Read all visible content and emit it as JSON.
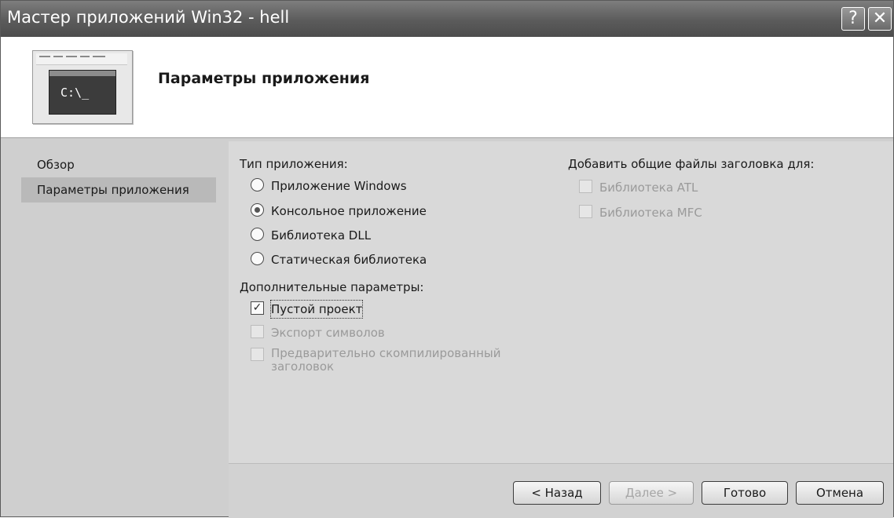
{
  "window": {
    "title": "Мастер приложений Win32 - hell"
  },
  "titlebar_buttons": {
    "help": "?",
    "close": "✕"
  },
  "header": {
    "heading": "Параметры приложения",
    "console_prompt": "C:\\_"
  },
  "nav": {
    "items": [
      {
        "label": "Обзор"
      },
      {
        "label": "Параметры приложения"
      }
    ]
  },
  "app_type": {
    "heading": "Тип приложения:",
    "options": [
      {
        "label": "Приложение Windows",
        "selected": false
      },
      {
        "label": "Консольное приложение",
        "selected": true
      },
      {
        "label": "Библиотека DLL",
        "selected": false
      },
      {
        "label": "Статическая библиотека",
        "selected": false
      }
    ]
  },
  "extra": {
    "heading": "Дополнительные параметры:",
    "options": [
      {
        "label": "Пустой проект",
        "checked": true,
        "enabled": true
      },
      {
        "label": "Экспорт символов",
        "checked": false,
        "enabled": false
      },
      {
        "label_line1": "Предварительно скомпилированный",
        "label_line2": "заголовок",
        "checked": false,
        "enabled": false
      }
    ]
  },
  "headers": {
    "heading": "Добавить общие файлы заголовка для:",
    "options": [
      {
        "label": "Библиотека ATL",
        "checked": false,
        "enabled": false
      },
      {
        "label": "Библиотека MFC",
        "checked": false,
        "enabled": false
      }
    ]
  },
  "buttons": {
    "back": "< Назад",
    "next": "Далее >",
    "finish": "Готово",
    "cancel": "Отмена"
  }
}
